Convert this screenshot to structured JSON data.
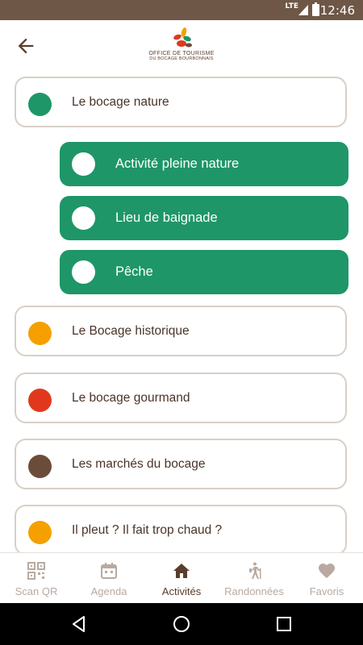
{
  "status_bar": {
    "network": "LTE",
    "time": "12:46"
  },
  "header": {
    "logo_line1": "OFFICE DE TOURISME",
    "logo_line2": "DU BOCAGE BOURBONNAIS"
  },
  "categories": [
    {
      "label": "Le bocage nature",
      "color": "#1e9668"
    },
    {
      "label": "Le Bocage historique",
      "color": "#f5a000"
    },
    {
      "label": "Le bocage gourmand",
      "color": "#e1381d"
    },
    {
      "label": "Les marchés du bocage",
      "color": "#6b4c3b"
    },
    {
      "label": "Il pleut ? Il fait trop chaud ?",
      "color": "#f5a000"
    }
  ],
  "subcategories": [
    {
      "label": "Activité pleine nature"
    },
    {
      "label": "Lieu de baignade"
    },
    {
      "label": "Pêche"
    }
  ],
  "bottom_nav": [
    {
      "label": "Scan QR",
      "icon": "qr-code-icon",
      "active": false
    },
    {
      "label": "Agenda",
      "icon": "calendar-icon",
      "active": false
    },
    {
      "label": "Activités",
      "icon": "home-icon",
      "active": true
    },
    {
      "label": "Randonnées",
      "icon": "hiker-icon",
      "active": false
    },
    {
      "label": "Favoris",
      "icon": "heart-icon",
      "active": false
    }
  ],
  "colors": {
    "brand_brown": "#6e5746",
    "green": "#1e9668",
    "inactive": "#b8aaa0"
  }
}
